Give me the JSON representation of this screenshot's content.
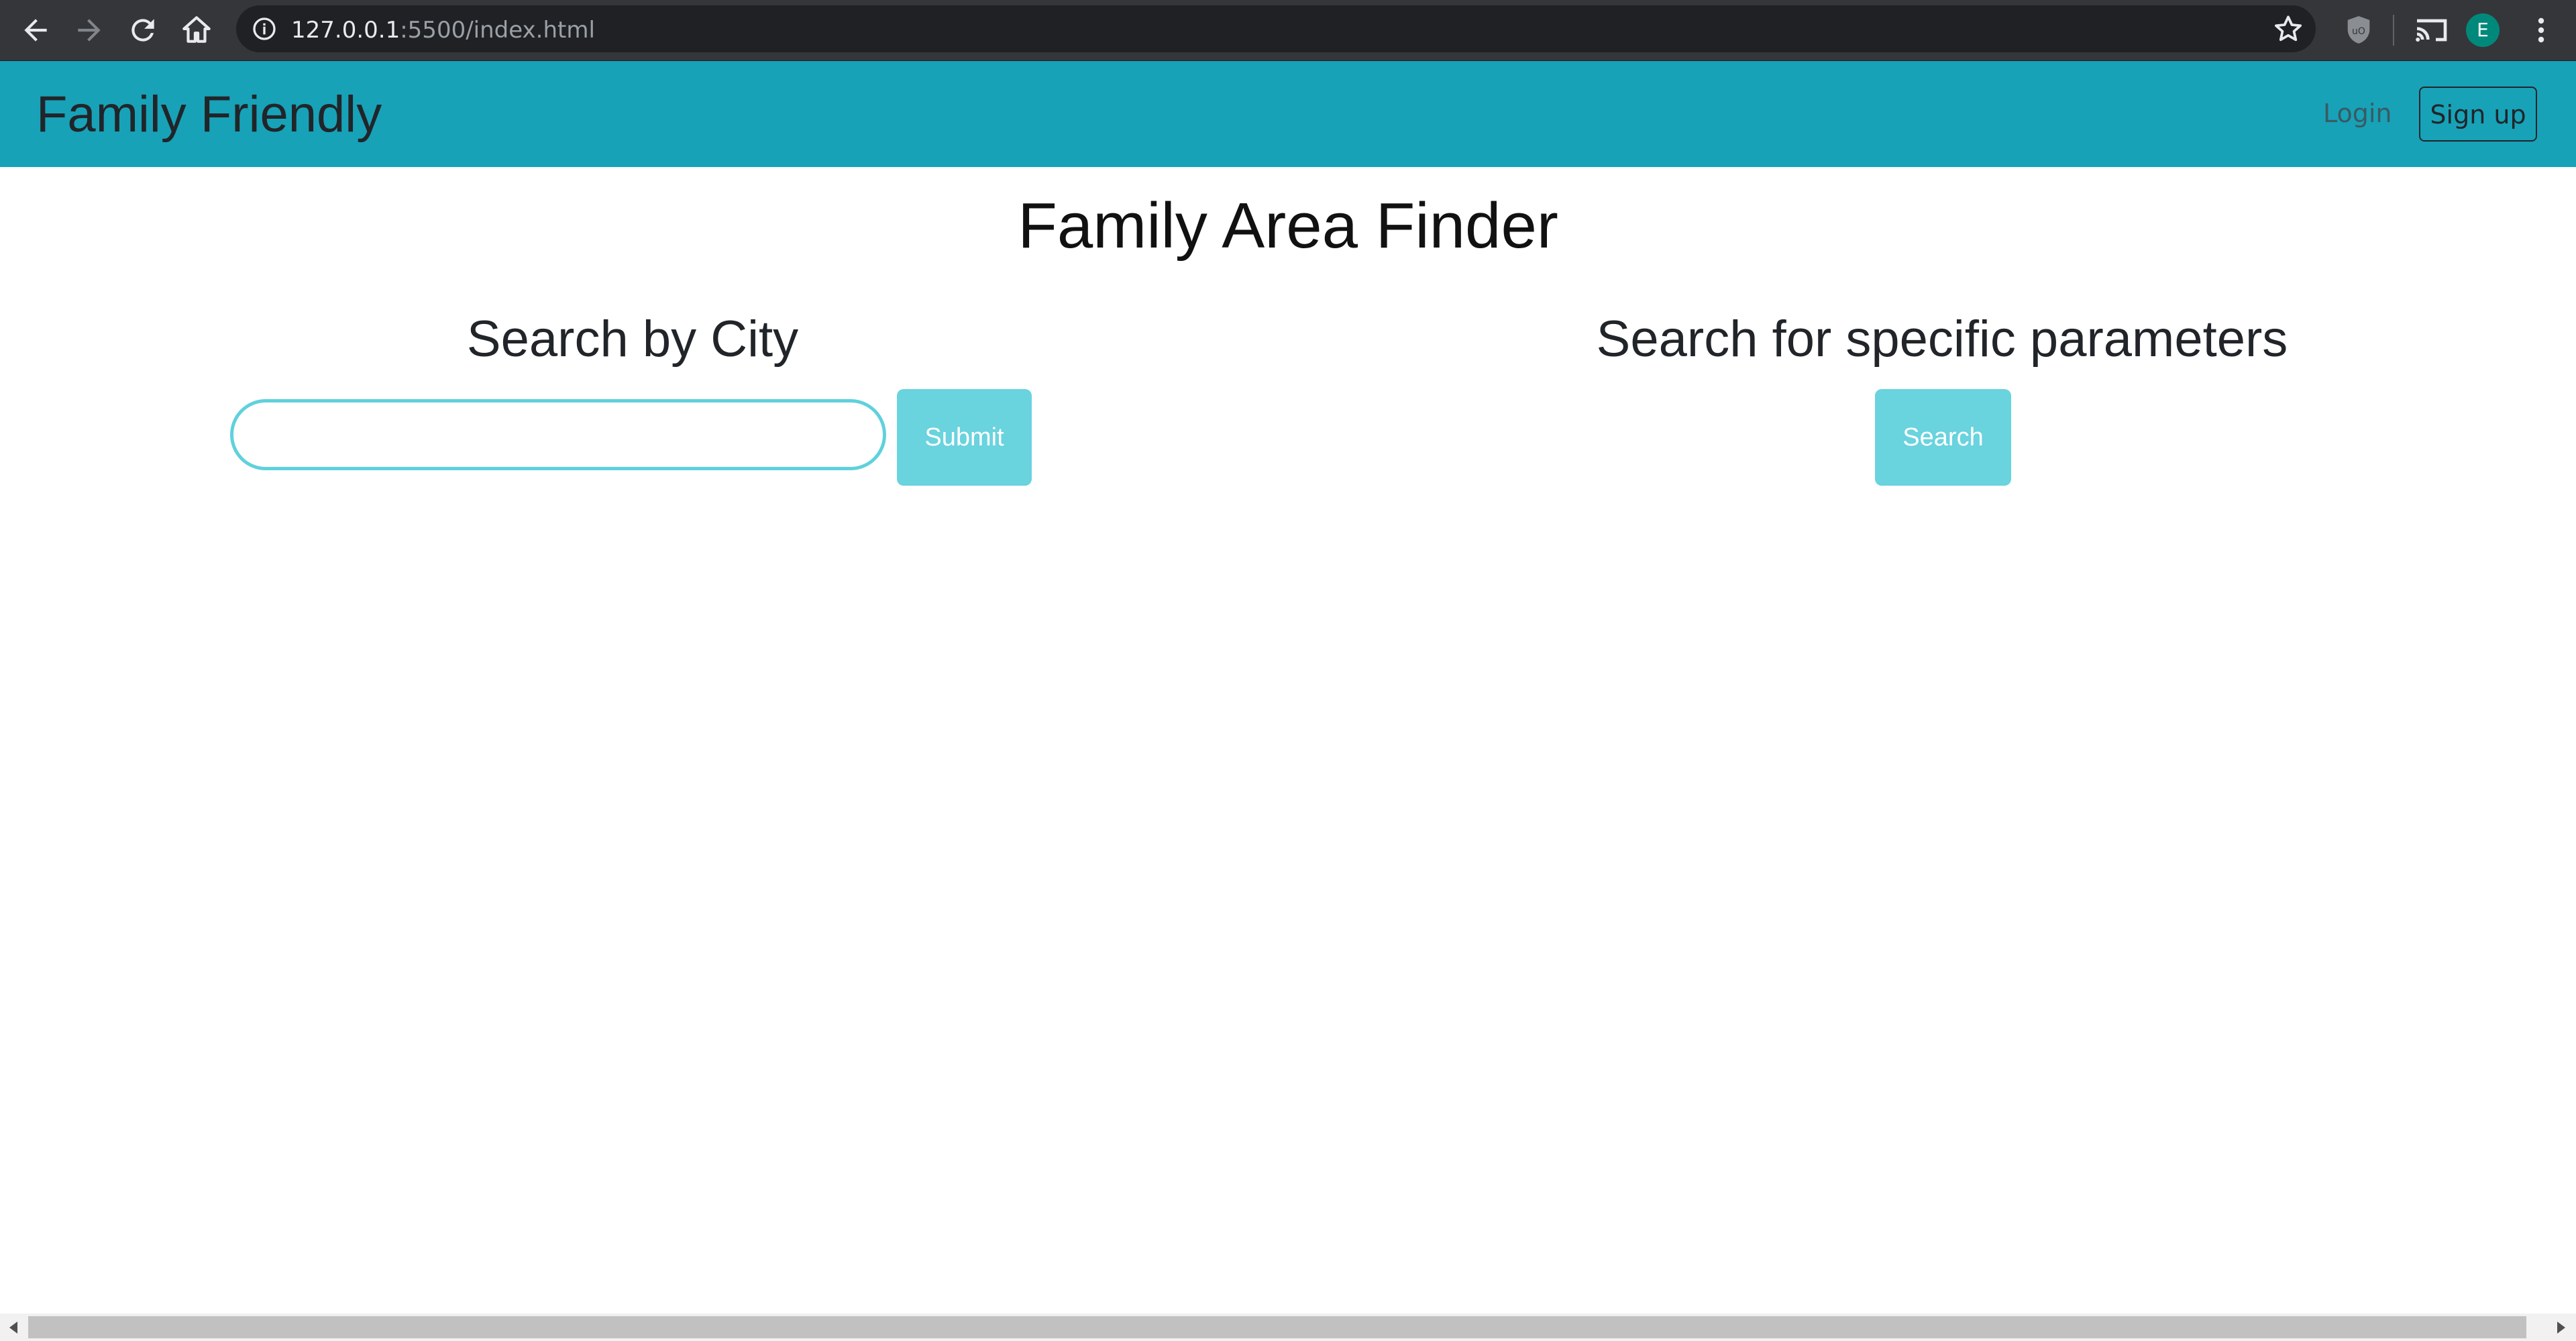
{
  "browser": {
    "url_host": "127.0.0.1",
    "url_path": ":5500/index.html",
    "profile_initial": "E",
    "icons": [
      "back-arrow-icon",
      "forward-arrow-icon",
      "reload-icon",
      "home-icon",
      "info-icon",
      "star-icon",
      "shield-extension-icon",
      "cast-icon",
      "profile-avatar",
      "kebab-menu-icon"
    ]
  },
  "navbar": {
    "brand": "Family Friendly",
    "login_label": "Login",
    "signup_label": "Sign up",
    "background": "#17a2b8"
  },
  "main": {
    "title": "Family Area Finder",
    "city_search": {
      "heading": "Search by City",
      "input_value": "",
      "submit_label": "Submit"
    },
    "param_search": {
      "heading": "Search for specific parameters",
      "search_label": "Search"
    },
    "button_color": "#69d3de",
    "input_border_color": "#5fd1dc"
  }
}
